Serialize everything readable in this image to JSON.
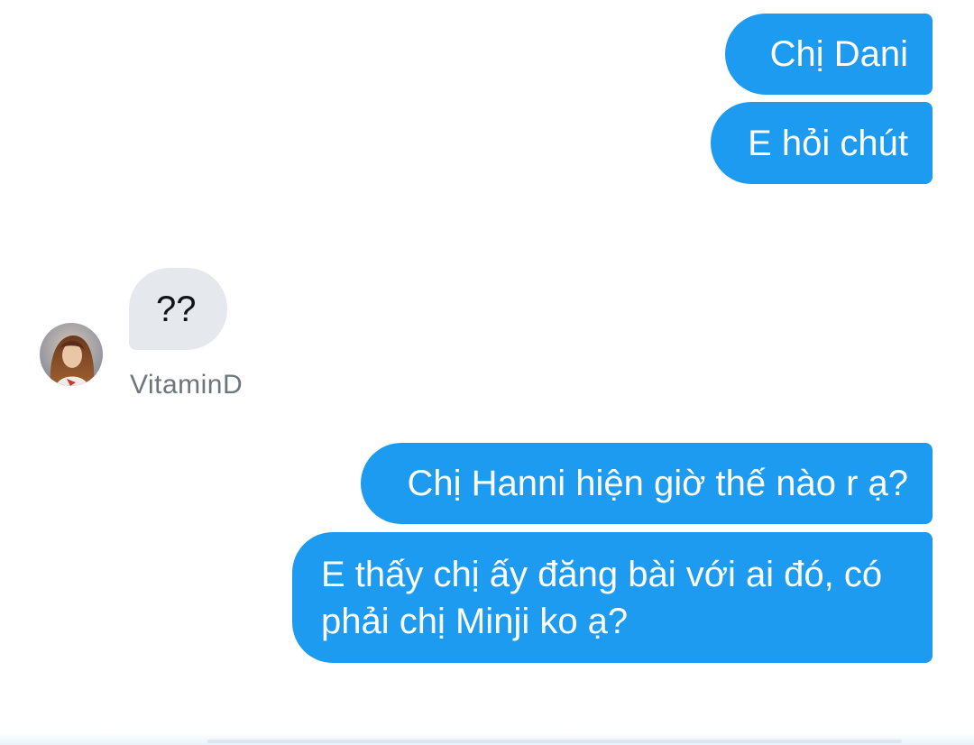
{
  "conversation": {
    "messages": [
      {
        "sender": "me",
        "text": "Chị Dani"
      },
      {
        "sender": "me",
        "text": "E hỏi chút"
      },
      {
        "sender": "them",
        "text": "??"
      },
      {
        "sender": "me",
        "text": "Chị Hanni hiện giờ thế nào r ạ?"
      },
      {
        "sender": "me",
        "text_line1": "E thấy chị ấy đăng bài với ai đó, có",
        "text_line2": "phải chị Minji ko ạ?"
      }
    ],
    "contact": {
      "name": "VitaminD",
      "avatar_icon": "user-avatar"
    }
  },
  "colors": {
    "outgoing_bubble": "#1d9bf0",
    "incoming_bubble": "#e5e9ee",
    "sender_name": "#6e767d"
  }
}
